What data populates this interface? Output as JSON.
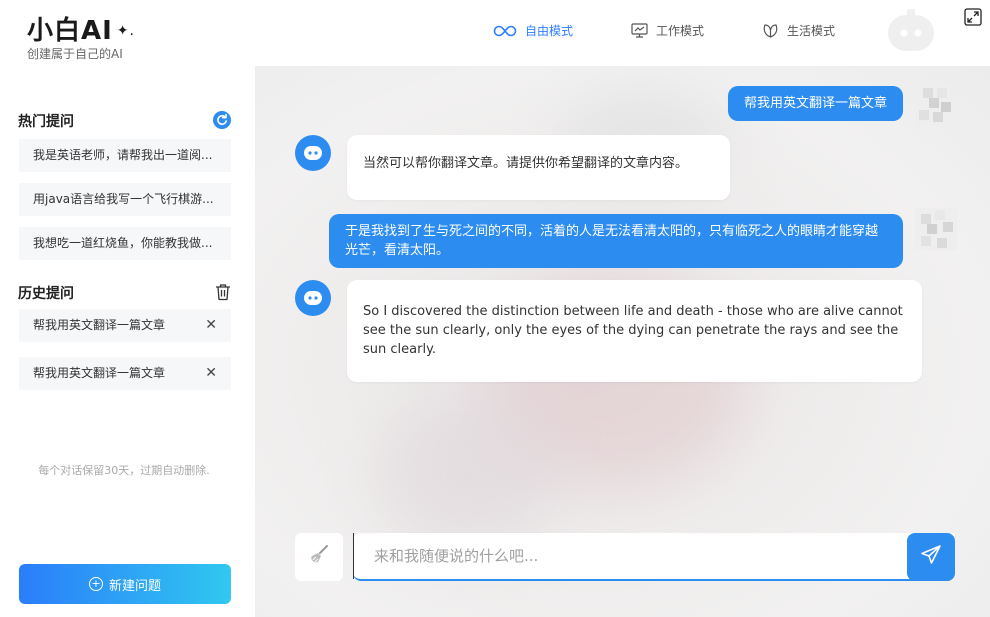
{
  "app": {
    "logo_text": "小白AI",
    "logo_spark": "✦.",
    "subtitle": "创建属于自己的AI"
  },
  "modes": [
    {
      "label": "自由模式",
      "icon": "infinity-icon",
      "active": true
    },
    {
      "label": "工作模式",
      "icon": "monitor-chart-icon",
      "active": false
    },
    {
      "label": "生活模式",
      "icon": "leaf-icon",
      "active": false
    }
  ],
  "sidebar": {
    "hot_title": "热门提问",
    "hot_items": [
      {
        "label": "我是英语老师，请帮我出一道阅..."
      },
      {
        "label": "用java语言给我写一个飞行棋游..."
      },
      {
        "label": "我想吃一道红烧鱼，你能教我做..."
      }
    ],
    "history_title": "历史提问",
    "history_items": [
      {
        "label": "帮我用英文翻译一篇文章",
        "close": "✕"
      },
      {
        "label": "帮我用英文翻译一篇文章",
        "close": "✕"
      }
    ],
    "retention_note": "每个对话保留30天，过期自动删除.",
    "new_button": "新建问题",
    "new_icon": "+"
  },
  "chat": {
    "messages": [
      {
        "role": "user",
        "text": "帮我用英文翻译一篇文章"
      },
      {
        "role": "ai",
        "text": "当然可以帮你翻译文章。请提供你希望翻译的文章内容。"
      },
      {
        "role": "user",
        "text": "于是我找到了生与死之间的不同，活着的人是无法看清太阳的，只有临死之人的眼睛才能穿越光芒，看清太阳。"
      },
      {
        "role": "ai",
        "text": "So I discovered the distinction between life and death - those who are alive cannot see the sun clearly, only the eyes of the dying can penetrate the rays and see the sun clearly."
      }
    ],
    "input_placeholder": "来和我随便说的什么吧...",
    "input_value": ""
  },
  "colors": {
    "accent": "#2d8cf0",
    "gradient_start": "#2b7dfa",
    "gradient_end": "#30c8f0"
  }
}
